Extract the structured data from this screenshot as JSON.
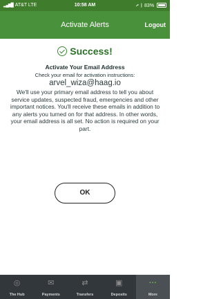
{
  "status_bar": {
    "carrier": "AT&T LTE",
    "time": "10:58 AM",
    "battery": "83%",
    "signal_icon": "signal-bars-icon",
    "location_icon": "location-arrow-icon",
    "bluetooth_icon": "bluetooth-icon",
    "battery_icon": "battery-icon"
  },
  "header": {
    "title": "Activate Alerts",
    "logout_label": "Logout"
  },
  "content": {
    "success": "Success!",
    "success_icon": "check-circle-icon",
    "activate_heading": "Activate Your Email Address",
    "instructions": "Check your email for activation instructions:",
    "email": "arvel_wiza@haag.io",
    "body": "We'll use your primary email address to tell you about service updates, suspected fraud, emergencies and other important notices. You'll receive these emails in addition to any alerts you turned on for that address. In other words, your email address is all set. No action is required on your part.",
    "ok_label": "OK"
  },
  "tabs": [
    {
      "label": "The Hub",
      "icon": "hub-icon"
    },
    {
      "label": "Payments",
      "icon": "payments-icon"
    },
    {
      "label": "Transfers",
      "icon": "transfers-icon"
    },
    {
      "label": "Deposits",
      "icon": "deposits-icon"
    },
    {
      "label": "More",
      "icon": "more-dots-icon",
      "active": true
    }
  ],
  "colors": {
    "header": "#49913a",
    "status_bar": "#3f7d2c",
    "success_text": "#2c6f28",
    "tab_bar": "#32373b",
    "accent": "#6fb34a"
  }
}
